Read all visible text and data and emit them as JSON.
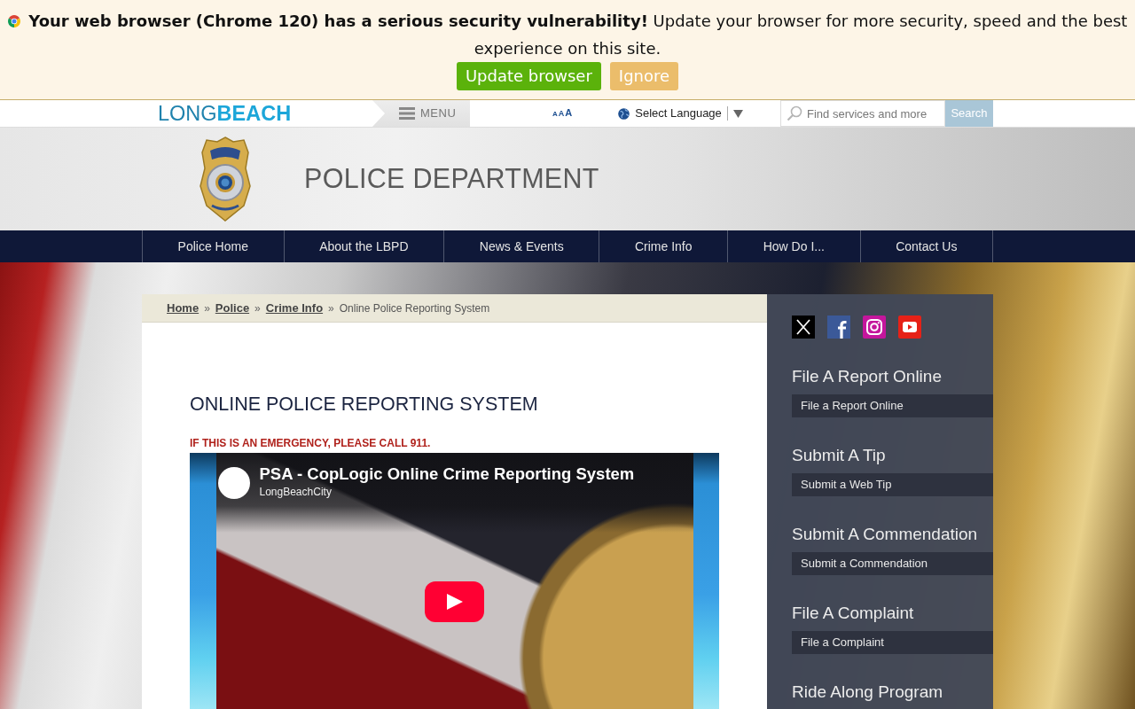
{
  "alert_banner": {
    "message": "**Your web browser (Chrome 120) has a serious security vulnerability!** Update your browser for more security, speed and the best experience on this site.",
    "buttons": [
      {
        "label": "Update browser",
        "kind": "primary"
      },
      {
        "label": "Ignore",
        "kind": "secondary"
      }
    ]
  },
  "utility_bar": {
    "logo": "LONG**BEACH**",
    "menu_label": "MENU",
    "text_size_options": [
      "A",
      "A",
      "A"
    ],
    "language_label": "Select Language",
    "search": {
      "placeholder": "Find services and more",
      "button": "Search"
    }
  },
  "header": {
    "title": "POLICE DEPARTMENT"
  },
  "nav_items": [
    "Police Home",
    "About the LBPD",
    "News & Events",
    "Crime Info",
    "How Do I...",
    "Contact Us"
  ],
  "breadcrumb": [
    {
      "kind": "link",
      "text": "Home"
    },
    {
      "kind": "separator",
      "text": "»"
    },
    {
      "kind": "link",
      "text": "Police"
    },
    {
      "kind": "separator",
      "text": "»"
    },
    {
      "kind": "link",
      "text": "Crime Info"
    },
    {
      "kind": "separator",
      "text": "»"
    },
    {
      "kind": "current",
      "text": "Online Police Reporting System"
    }
  ],
  "content": {
    "title": "ONLINE POLICE REPORTING SYSTEM",
    "notice": "IF THIS IS AN EMERGENCY, PLEASE CALL 911.",
    "video": {
      "title": "PSA - CopLogic Online Crime Reporting System",
      "channel": "LongBeachCity"
    }
  },
  "sidebar": {
    "sections": [
      {
        "heading": "File A Report Online",
        "links": [
          "File a Report Online"
        ]
      },
      {
        "heading": "Submit A Tip",
        "links": [
          "Submit a Web Tip"
        ]
      },
      {
        "heading": "Submit A Commendation",
        "links": [
          "Submit a Commendation"
        ]
      },
      {
        "heading": "File A Complaint",
        "links": [
          "File a Complaint"
        ]
      },
      {
        "heading": "Ride Along Program"
      }
    ]
  }
}
